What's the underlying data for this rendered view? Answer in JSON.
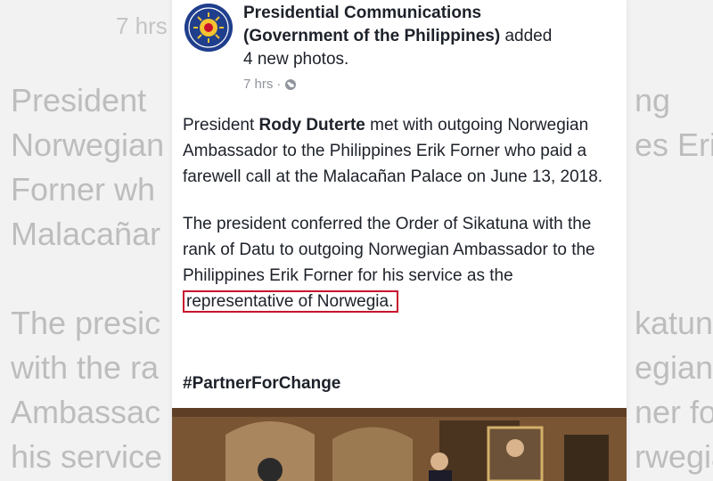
{
  "background": {
    "time": "7 hrs",
    "lines_left": [
      "President",
      "Norwegian",
      "Forner wh",
      "Malacañar",
      "The presic",
      "with the ra",
      "Ambassac",
      "his service"
    ],
    "lines_right": [
      "ng",
      "es Eri",
      "",
      "",
      "katuna",
      "egian",
      "ner for",
      "rwegia"
    ]
  },
  "post": {
    "author": "Presidential Communications (Government of the Philippines)",
    "author_line1": "Presidential Communications",
    "author_line2": "(Government of the Philippines)",
    "action": " added",
    "action_line2": "4 new photos.",
    "time": "7 hrs",
    "separator": "·",
    "icons": {
      "visibility": "globe-icon",
      "avatar": "government-seal"
    },
    "paragraph1_prefix": "President ",
    "paragraph1_bold": "Rody Duterte",
    "paragraph1_rest": " met with outgoing Norwegian Ambassador to the Philippines Erik Forner who paid a farewell call at the Malacañan Palace on June 13, 2018.",
    "paragraph2_prefix": "The president conferred the Order of Sikatuna with the rank of Datu to outgoing Norwegian Ambassador to the Philippines Erik Forner for his service  as the ",
    "paragraph2_highlight": "representative of Norwegia.",
    "hashtag": "#PartnerForChange",
    "highlight_color": "#c8102e"
  }
}
